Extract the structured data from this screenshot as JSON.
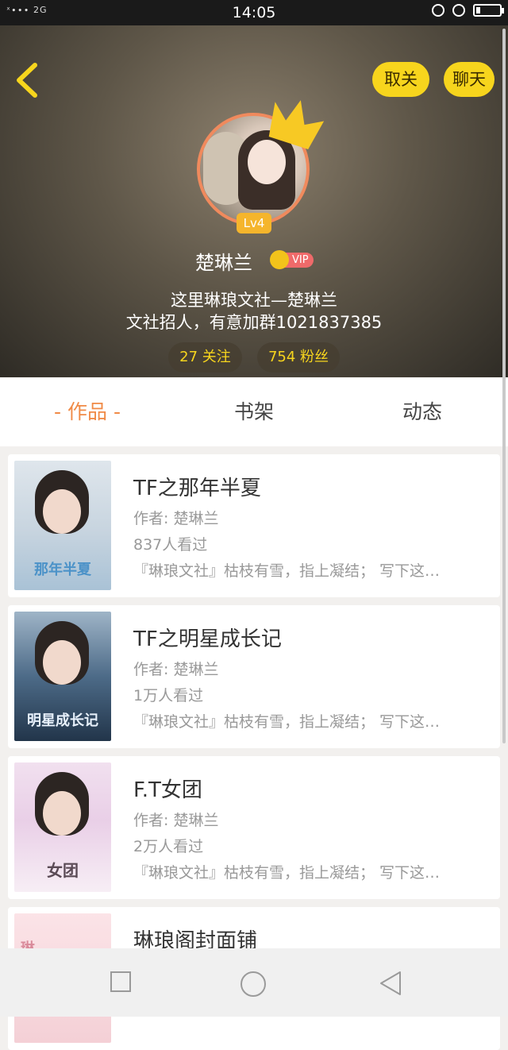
{
  "status_bar": {
    "signal": "ˣ∙∙∙ 2G",
    "time": "14:05",
    "battery_level": 0.18
  },
  "header": {
    "unfollow_label": "取关",
    "chat_label": "聊天",
    "level": "Lv4",
    "username": "楚琳兰",
    "vip_label": "VIP",
    "bio_line1": "这里琳琅文社—楚琳兰",
    "bio_line2": "文社招人，有意加群1021837385",
    "following": "27 关注",
    "fans": "754 粉丝",
    "colors": {
      "accent": "#f7d51d",
      "avatar_ring": "#f08a5d"
    }
  },
  "tabs": {
    "works": "- 作品 -",
    "shelf": "书架",
    "dynamics": "动态",
    "active_color": "#f08a46"
  },
  "works": [
    {
      "title": "TF之那年半夏",
      "author": "作者: 楚琳兰",
      "views": "837人看过",
      "desc": "『琳琅文社』枯枝有雪，指上凝结； 写下这…",
      "cover_text": "那年半夏"
    },
    {
      "title": "TF之明星成长记",
      "author": "作者: 楚琳兰",
      "views": "1万人看过",
      "desc": "『琳琅文社』枯枝有雪，指上凝结； 写下这…",
      "cover_text": "明星成长记"
    },
    {
      "title": "F.T女团",
      "author": "作者: 楚琳兰",
      "views": "2万人看过",
      "desc": "『琳琅文社』枯枝有雪，指上凝结； 写下这…",
      "cover_text": "女团"
    },
    {
      "title": "琳琅阁封面铺",
      "cover_text": "琳"
    }
  ],
  "icons": [
    "back-arrow-icon",
    "crown-icon",
    "square-nav-icon",
    "circle-nav-icon",
    "triangle-nav-icon"
  ]
}
